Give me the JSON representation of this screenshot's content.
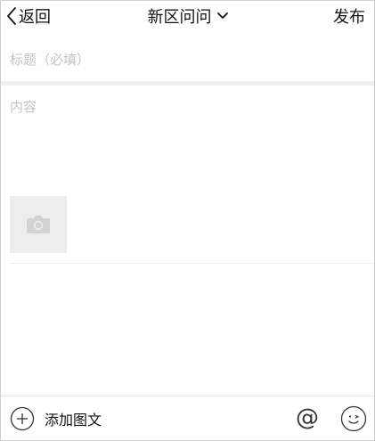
{
  "header": {
    "back_label": "返回",
    "title": "新区问问",
    "publish_label": "发布"
  },
  "form": {
    "title_placeholder": "标题（必填）",
    "content_placeholder": "内容"
  },
  "toolbar": {
    "add_media_label": "添加图文",
    "mention_symbol": "@"
  },
  "icons": {
    "back": "chevron-left-icon",
    "dropdown": "chevron-down-icon",
    "photo": "camera-icon",
    "add": "plus-circle-icon",
    "emoji": "smiley-icon"
  }
}
